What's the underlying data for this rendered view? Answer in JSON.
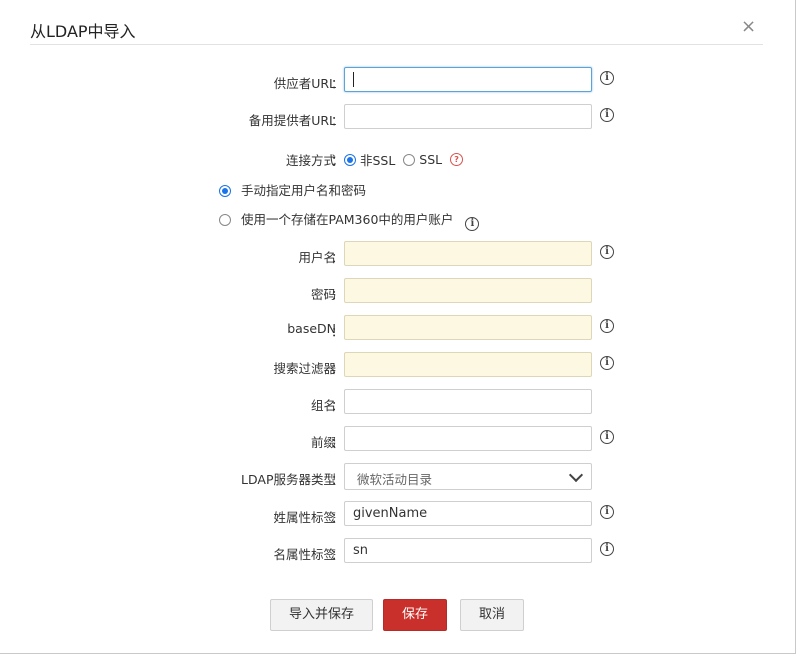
{
  "dialog": {
    "title": "从LDAP中导入",
    "close": "×"
  },
  "fields": {
    "provider_url": {
      "label": "供应者URL",
      "value": ""
    },
    "backup_provider_url": {
      "label": "备用提供者URL",
      "value": ""
    },
    "connection_type": {
      "label": "连接方式",
      "options": [
        "非SSL",
        "SSL"
      ],
      "selected": "非SSL",
      "help": "?"
    },
    "username": {
      "label": "用户名",
      "value": ""
    },
    "password": {
      "label": "密码",
      "value": ""
    },
    "base_dn": {
      "label": "baseDN",
      "value": ""
    },
    "search_filter": {
      "label": "搜索过滤器",
      "value": ""
    },
    "group_name": {
      "label": "组名",
      "value": ""
    },
    "prefix": {
      "label": "前缀",
      "value": ""
    },
    "server_type": {
      "label": "LDAP服务器类型",
      "value": "微软活动目录"
    },
    "last_name_attr": {
      "label": "姓属性标签",
      "value": "givenName"
    },
    "first_name_attr": {
      "label": "名属性标签",
      "value": "sn"
    }
  },
  "credentials_mode": {
    "manual": "手动指定用户名和密码",
    "stored": "使用一个存储在PAM360中的用户账户",
    "selected": "manual"
  },
  "colon": "：",
  "info_glyph": "i",
  "buttons": {
    "import_save": "导入并保存",
    "save": "保存",
    "cancel": "取消"
  },
  "colors": {
    "primary": "#c9302c",
    "radio_selected": "#1a73e8",
    "required_bg": "#fdf8e1"
  }
}
